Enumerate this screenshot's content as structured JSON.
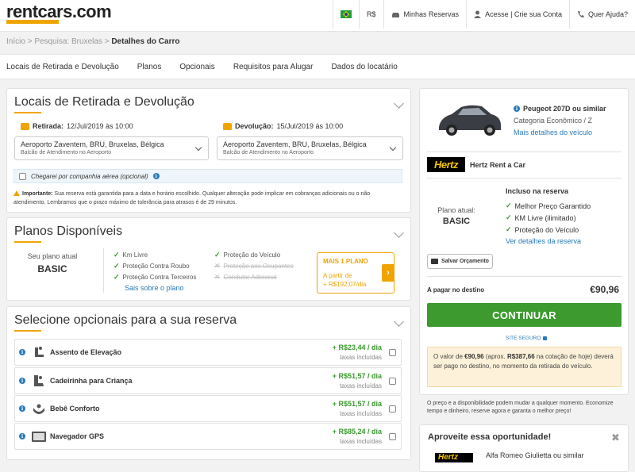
{
  "header": {
    "logo": "rentcars.com",
    "currency": "R$",
    "my_reservations": "Minhas Reservas",
    "account": "Acesse | Crie sua Conta",
    "help": "Quer Ajuda?",
    "brand_color": "#f0a400"
  },
  "breadcrumb": {
    "home": "Início",
    "search": "Pesquisa: Bruxelas",
    "current": "Detalhes do Carro",
    "sep": ">"
  },
  "tabs": [
    "Locais de Retirada e Devolução",
    "Planos",
    "Opcionais",
    "Requisitos para Alugar",
    "Dados do locatário"
  ],
  "locations": {
    "title": "Locais de Retirada e Devolução",
    "pickup_label": "Retirada:",
    "pickup_date": "12/Jul/2019 às 10:00",
    "dropoff_label": "Devolução:",
    "dropoff_date": "15/Jul/2019 às 10:00",
    "pickup_place": "Aeroporto Zaventem, BRU, Bruxelas, Bélgica",
    "pickup_counter": "Balcão de Atendimento no Aeroporto",
    "dropoff_place": "Aeroporto Zaventem, BRU, Bruxelas, Bélgica",
    "dropoff_counter": "Balcão de Atendimento no Aeroporto",
    "airline_checkbox": "Chegarei por companhia aérea (opcional)",
    "warning_bold": "Importante:",
    "warning_text": " Sua reserva está garantida para a data e horário escolhido. Qualquer alteração pode implicar em cobranças adicionais ou o não atendimento. Lembramos que o prazo máximo de tolerância para atrasos é de 29 minutos."
  },
  "plans": {
    "title": "Planos Disponíveis",
    "current_label": "Seu plano atual",
    "current_name": "BASIC",
    "features_col1": [
      {
        "text": "Km Livre",
        "included": true
      },
      {
        "text": "Proteção Contra Roubo",
        "included": true
      },
      {
        "text": "Proteção Contra Terceiros",
        "included": true
      }
    ],
    "features_col2": [
      {
        "text": "Proteção do Veículo",
        "included": true
      },
      {
        "text": "Proteção aos Ocupantes",
        "included": false
      },
      {
        "text": "Condutor Adicional",
        "included": false
      }
    ],
    "more_link": "Sais sobre o plano",
    "upgrade_title": "MAIS 1 PLANO",
    "upgrade_from": "A partir de",
    "upgrade_price": "+ R$192,07/dia",
    "upgrade_arrow": "›"
  },
  "optionals": {
    "title": "Selecione opcionais para a sua reserva",
    "items": [
      {
        "name": "Assento de Elevação",
        "price": "+ R$23,44 / dia",
        "tax": "taxas incluídas",
        "icon": "booster-seat-icon"
      },
      {
        "name": "Cadeirinha para Criança",
        "price": "+ R$51,57 / dia",
        "tax": "taxas incluídas",
        "icon": "child-seat-icon"
      },
      {
        "name": "Bebê Conforto",
        "price": "+ R$51,57 / dia",
        "tax": "taxas incluídas",
        "icon": "baby-seat-icon"
      },
      {
        "name": "Navegador GPS",
        "price": "+ R$85,24 / dia",
        "tax": "taxas incluídas",
        "icon": "gps-icon"
      }
    ]
  },
  "summary": {
    "car_name": "Peugeot 207D ou similar",
    "car_category": "Categoria Econômico / Z",
    "car_more": "Mais detalhes do veículo",
    "company_logo": "Hertz",
    "company_name": "Hertz Rent a Car",
    "plan_label": "Plano atual:",
    "plan_name": "BASIC",
    "included_title": "Incluso na reserva",
    "included": [
      "Melhor Preço Garantido",
      "KM Livre (ilimitado)",
      "Proteção do Veículo"
    ],
    "reservation_more": "Ver detalhes da reserva",
    "save_quote": "Salvar Orçamento",
    "pay_label": "A pagar no destino",
    "pay_value": "€90,96",
    "continue": "CONTINUAR",
    "secure_site": "SITE SEGURO",
    "note_1": "O valor de ",
    "note_value": "€90,96",
    "note_2": " (aprox. ",
    "note_brl": "R$387,66",
    "note_3": " na cotação de hoje) deverá ser pago no destino, no momento da retirada do veículo.",
    "disclaimer": "O preço e a disponibilidade podem mudar a qualquer momento. Economize tempo e dinheiro, reserve agora e garanta o melhor preço!",
    "opportunity_title": "Aproveite essa oportunidade!",
    "opportunity_close": "✖",
    "opportunity_car": "Alfa Romeo Giulietta ou similar",
    "opportunity_logo": "Hertz",
    "continue_color": "#3c9a2f"
  }
}
